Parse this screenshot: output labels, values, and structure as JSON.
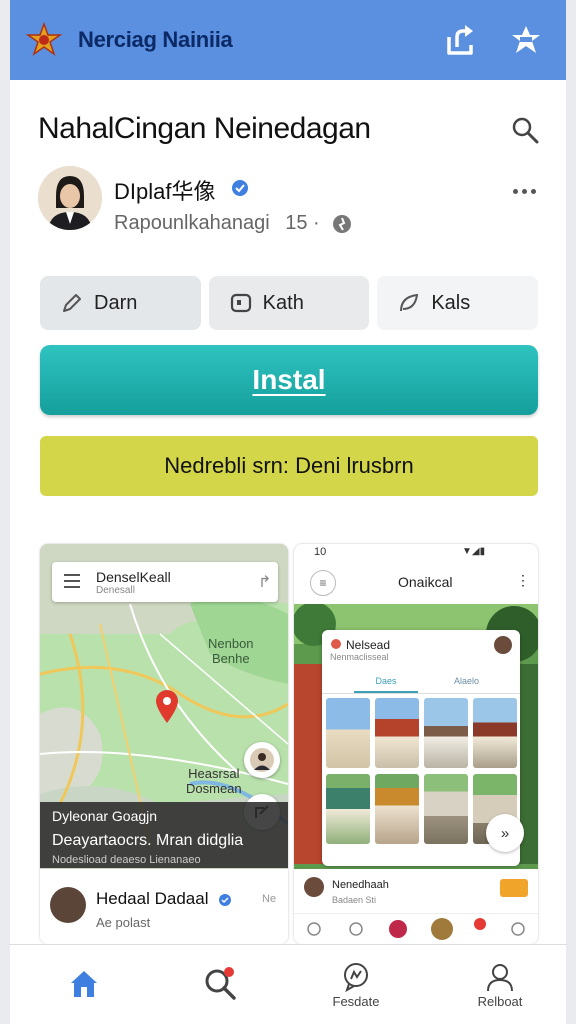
{
  "app_bar": {
    "title": "Nerciag Nainiia",
    "icons": [
      "logo-star-icon",
      "share-icon",
      "bookmark-star-icon"
    ]
  },
  "header": {
    "title": "NahalCingan Neinedagan",
    "developer_name": "DIplaf华像",
    "developer_meta": "Rapounlkahanagi",
    "developer_meta_count": "15 ·"
  },
  "chips": [
    {
      "label": "Darn",
      "icon": "pencil-icon"
    },
    {
      "label": "Kath",
      "icon": "chat-square-icon"
    },
    {
      "label": "Kals",
      "icon": "leaf-icon"
    }
  ],
  "install_label": "Instal",
  "banner_text": "Nedrebli srn: Deni lrusbrn",
  "screenshot1": {
    "search_title": "DenselKeall",
    "search_sub": "Denesall",
    "map_label_a": "Nenbon",
    "map_label_b": "Benhe",
    "map_label_c": "Heasrsal",
    "map_label_d": "Dosmean",
    "overlay_line1": "Dyleonar Goagjn",
    "overlay_line2": "Deayartaocrs. Mran didglia",
    "overlay_line3": "Nodeslioad deaeso Lienanaeo",
    "footer_name": "Hedaal Dadaal",
    "footer_sub": "Ae polast",
    "footer_tag": "Ne"
  },
  "screenshot2": {
    "status_time": "10",
    "title": "Onaikcal",
    "card_title": "Nelsead",
    "card_sub": "Nenmaclisseal",
    "tab_a": "Daes",
    "tab_b": "Alaelo",
    "footer_name": "Nenedhaah",
    "footer_sub": "Badaen Sti"
  },
  "bottom_nav": [
    {
      "label": "",
      "icon": "home-icon"
    },
    {
      "label": "",
      "icon": "search-icon"
    },
    {
      "label": "Fesdate",
      "icon": "chat-icon"
    },
    {
      "label": "Relboat",
      "icon": "person-icon"
    }
  ],
  "colors": {
    "app_bar": "#5b8fe0",
    "install": "#1fb0ad",
    "banner": "#d4d64a",
    "accent_blue": "#3f7fe0",
    "notification": "#e53935"
  }
}
